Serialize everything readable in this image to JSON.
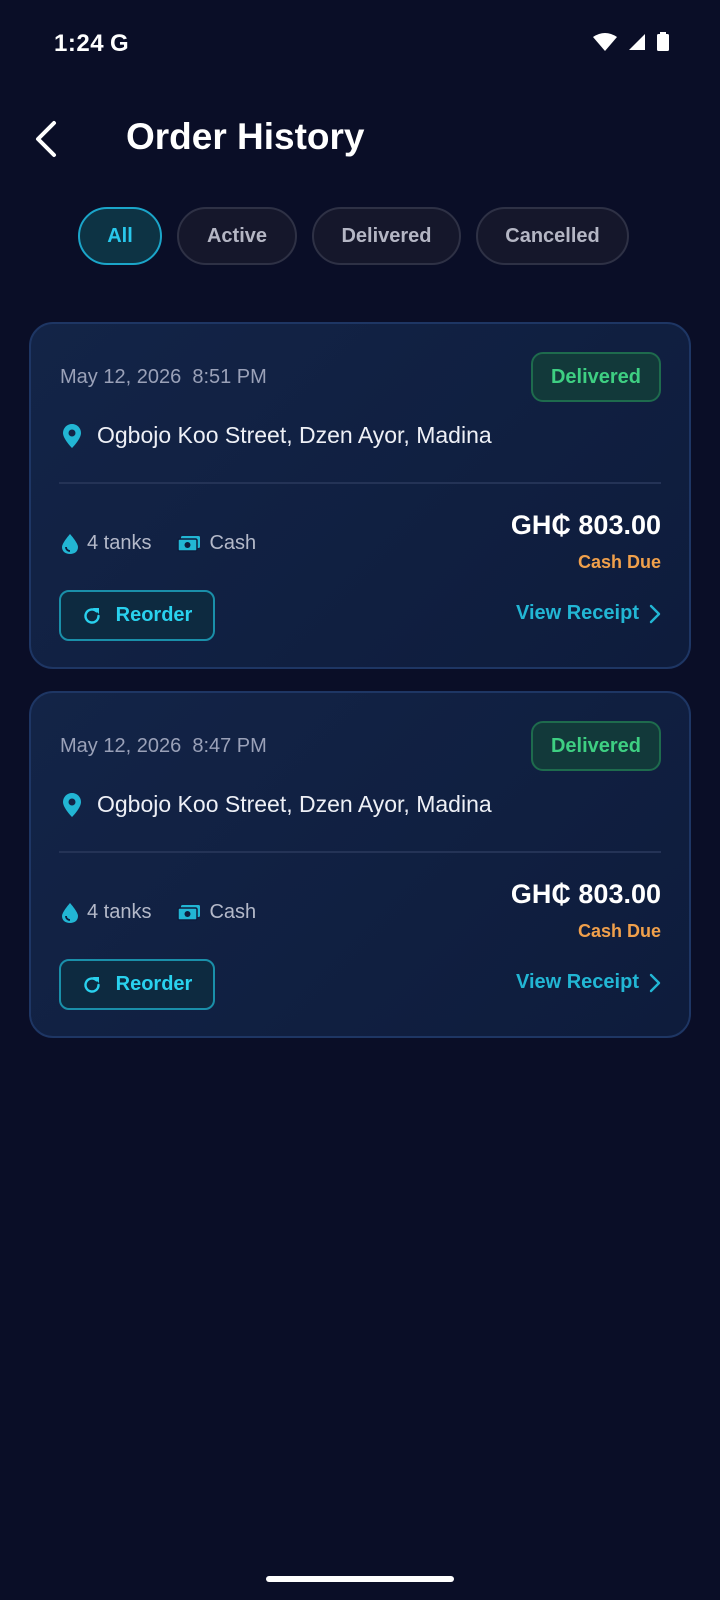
{
  "status_bar": {
    "time": "1:24",
    "g_logo": "G",
    "icons": [
      "wifi-icon",
      "signal-icon",
      "battery-icon"
    ]
  },
  "header": {
    "back_icon": "chevron-left-icon",
    "title": "Order History"
  },
  "tabs": [
    {
      "label": "All",
      "selected": true
    },
    {
      "label": "Active",
      "selected": false
    },
    {
      "label": "Delivered",
      "selected": false
    },
    {
      "label": "Cancelled",
      "selected": false
    }
  ],
  "orders": [
    {
      "date": "May 12, 2026",
      "time": "8:51 PM",
      "status": "Delivered",
      "address": "Ogbojo Koo Street, Dzen Ayor, Madina",
      "tanks": "4 tanks",
      "payment_method": "Cash",
      "amount": "GH₵ 803.00",
      "payment_status": "Cash Due",
      "reorder_label": "Reorder",
      "receipt_label": "View Receipt"
    },
    {
      "date": "May 12, 2026",
      "time": "8:47 PM",
      "status": "Delivered",
      "address": "Ogbojo Koo Street, Dzen Ayor, Madina",
      "tanks": "4 tanks",
      "payment_method": "Cash",
      "amount": "GH₵ 803.00",
      "payment_status": "Cash Due",
      "reorder_label": "Reorder",
      "receipt_label": "View Receipt"
    }
  ],
  "colors": {
    "background": "#0a0e27",
    "accent": "#29c8ec",
    "success": "#3ecf82",
    "warning": "#f0a04b"
  }
}
